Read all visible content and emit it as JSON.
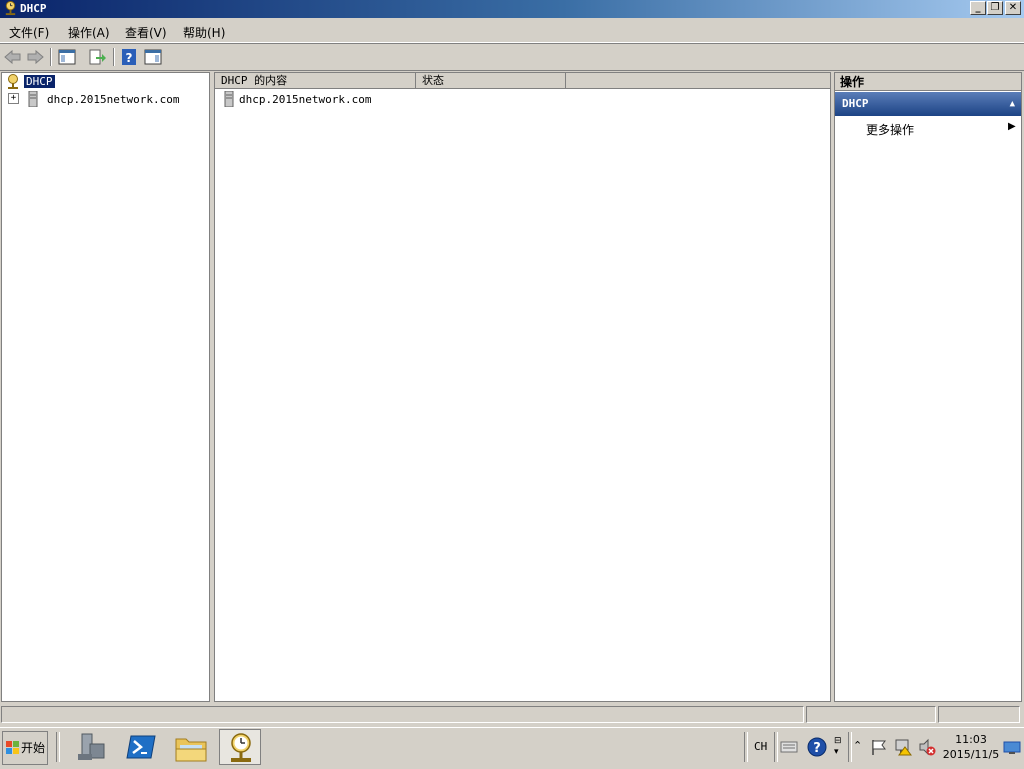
{
  "window": {
    "title": "DHCP"
  },
  "menu": [
    {
      "label": "文件(F)"
    },
    {
      "label": "操作(A)"
    },
    {
      "label": "查看(V)"
    },
    {
      "label": "帮助(H)"
    }
  ],
  "tree": {
    "root_label": "DHCP",
    "children": [
      {
        "expander": "+",
        "label": "dhcp.2015network.com"
      }
    ]
  },
  "content": {
    "columns": [
      "DHCP 的内容",
      "状态"
    ],
    "rows": [
      {
        "name": "dhcp.2015network.com",
        "status": ""
      }
    ]
  },
  "actions": {
    "title": "操作",
    "section": "DHCP",
    "items": [
      {
        "label": "更多操作"
      }
    ]
  },
  "taskbar": {
    "start_label": "开始",
    "lang": "CH",
    "time": "11:03",
    "date": "2015/11/5"
  },
  "colors": {
    "title_dark": "#0a246a",
    "title_light": "#a6caf0",
    "selection": "#0a246a",
    "face": "#d4d0c8"
  }
}
